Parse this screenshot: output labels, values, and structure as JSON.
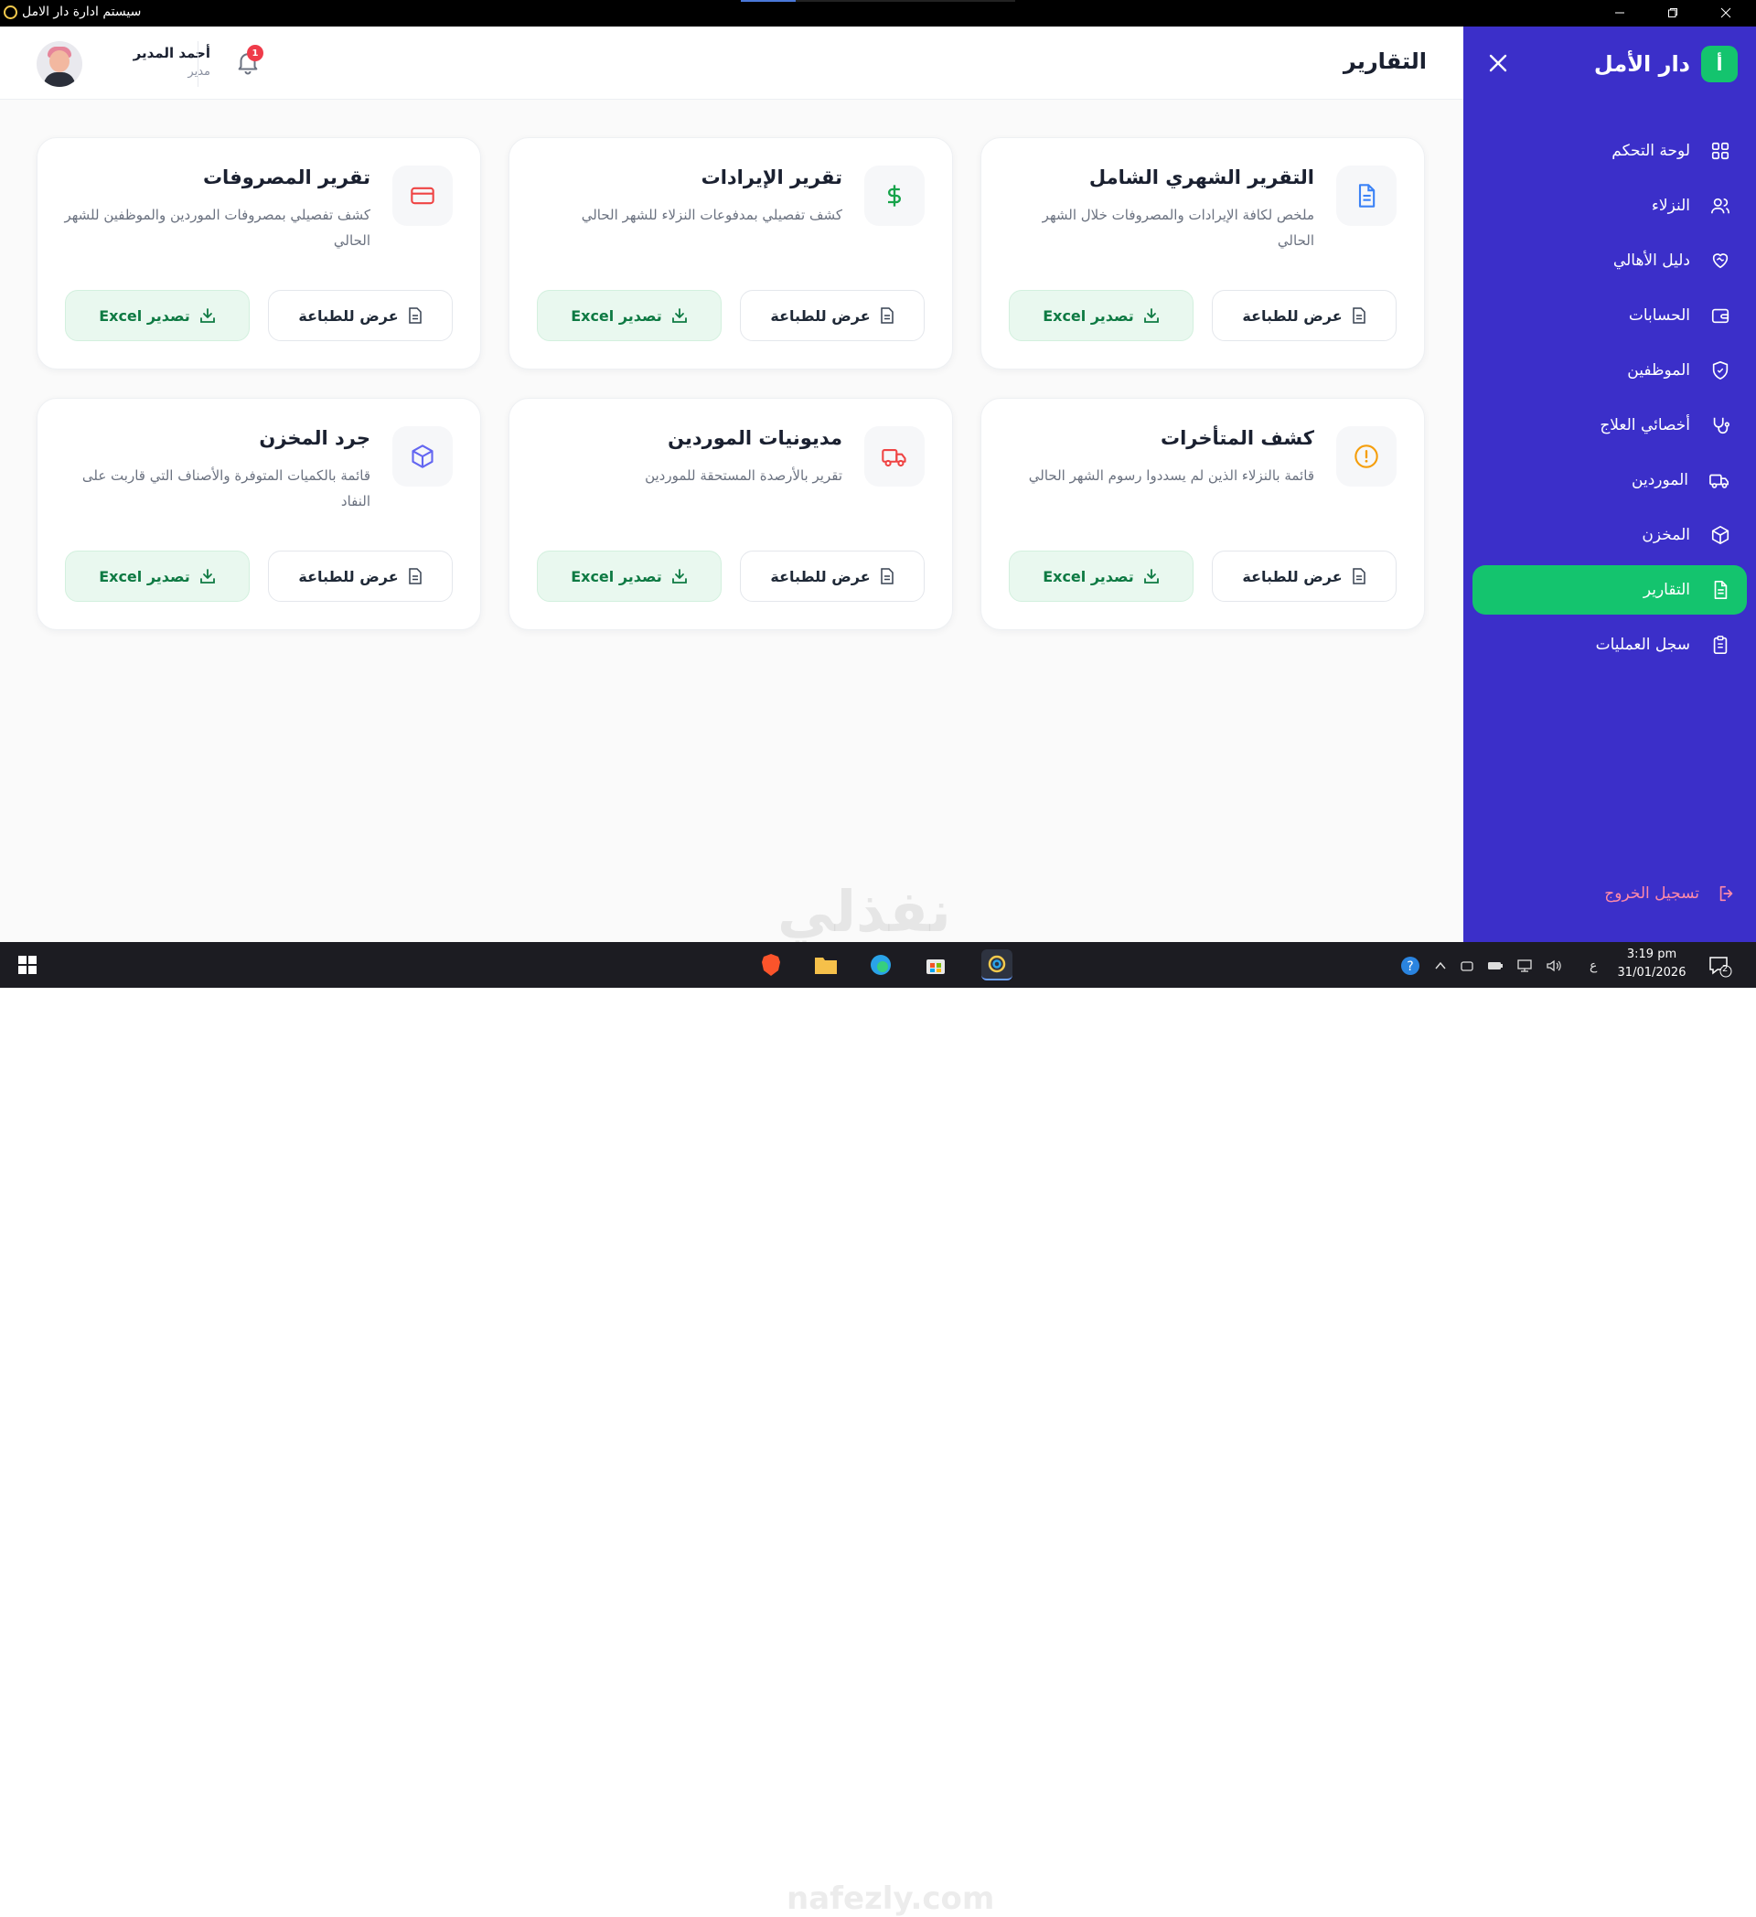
{
  "window": {
    "title": "سيستم ادارة دار الامل"
  },
  "header": {
    "page_title": "التقارير",
    "user_name": "أحمد المدير",
    "user_role": "مدير",
    "notification_count": "1"
  },
  "sidebar": {
    "brand_logo": "أ",
    "brand_name": "دار الأمل",
    "items": [
      {
        "label": "لوحة التحكم",
        "icon": "dashboard-grid-icon"
      },
      {
        "label": "النزلاء",
        "icon": "users-icon"
      },
      {
        "label": "دليل الأهالي",
        "icon": "heart-handshake-icon"
      },
      {
        "label": "الحسابات",
        "icon": "wallet-icon"
      },
      {
        "label": "الموظفين",
        "icon": "shield-icon"
      },
      {
        "label": "أخصائي العلاج",
        "icon": "stethoscope-icon"
      },
      {
        "label": "الموردين",
        "icon": "truck-icon"
      },
      {
        "label": "المخزن",
        "icon": "box-icon"
      },
      {
        "label": "التقارير",
        "icon": "report-file-icon",
        "active": true
      },
      {
        "label": "سجل العمليات",
        "icon": "clipboard-icon"
      }
    ],
    "logout": "تسجيل الخروج"
  },
  "buttons": {
    "print": "عرض للطباعة",
    "excel": "تصدير Excel"
  },
  "cards": [
    {
      "title": "التقرير الشهري الشامل",
      "desc": "ملخص لكافة الإيرادات والمصروفات خلال الشهر الحالي",
      "icon": "document-icon",
      "color": "#3b82f6"
    },
    {
      "title": "تقرير الإيرادات",
      "desc": "كشف تفصيلي بمدفوعات النزلاء للشهر الحالي",
      "icon": "dollar-icon",
      "color": "#16a34a"
    },
    {
      "title": "تقرير المصروفات",
      "desc": "كشف تفصيلي بمصروفات الموردين والموظفين للشهر الحالي",
      "icon": "credit-card-icon",
      "color": "#ef4444"
    },
    {
      "title": "كشف المتأخرات",
      "desc": "قائمة بالنزلاء الذين لم يسددوا رسوم الشهر الحالي",
      "icon": "alert-circle-icon",
      "color": "#f59e0b"
    },
    {
      "title": "مديونيات الموردين",
      "desc": "تقرير بالأرصدة المستحقة للموردين",
      "icon": "truck-icon",
      "color": "#ef4444"
    },
    {
      "title": "جرد المخزن",
      "desc": "قائمة بالكميات المتوفرة والأصناف التي قاربت على النفاد",
      "icon": "box-icon",
      "color": "#6366f1"
    }
  ],
  "taskbar": {
    "input_lang": "ع",
    "time": "3:19 pm",
    "date": "31/01/2026",
    "notif_count": "2"
  },
  "watermark": {
    "brand": "نفذلي",
    "site": "nafezly.com"
  },
  "colors": {
    "sidebar": "#3b2fc9",
    "accent_green": "#14c46e",
    "logout": "#ff8aa8"
  }
}
